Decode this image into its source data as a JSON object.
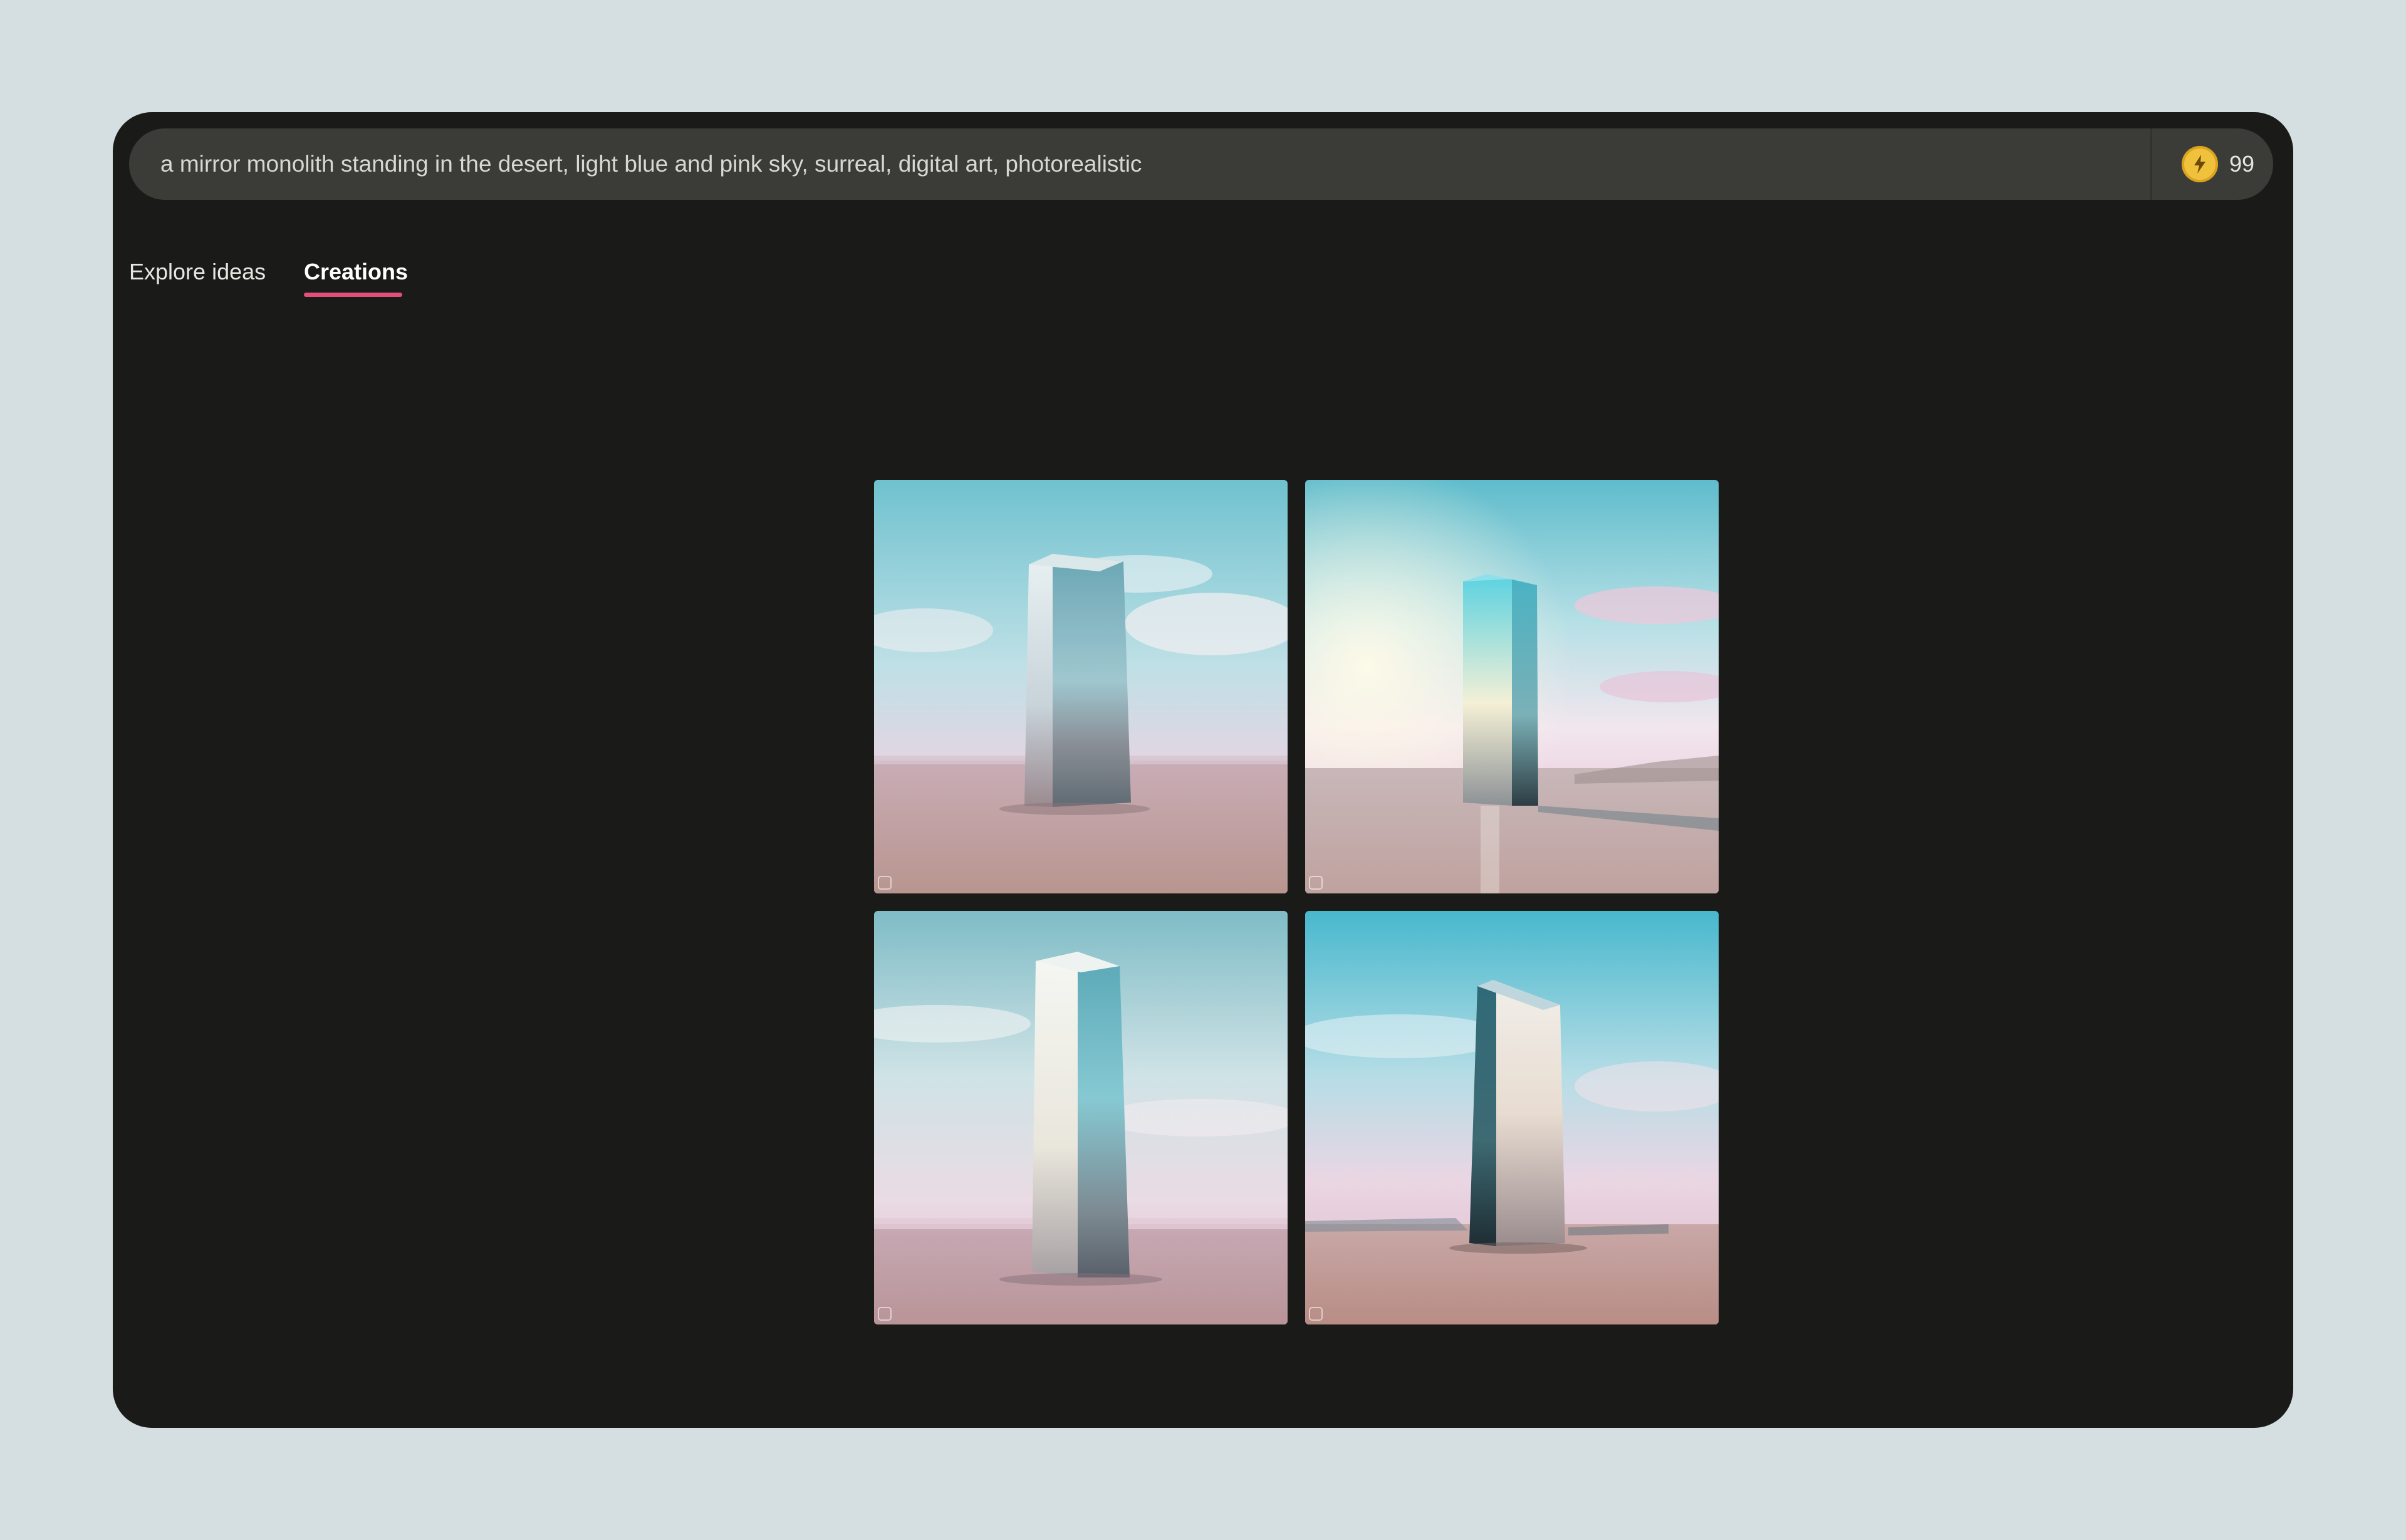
{
  "prompt": {
    "text": "a mirror monolith standing in the desert, light blue and pink sky, surreal, digital art, photorealistic"
  },
  "credits": {
    "icon": "lightning-coin-icon",
    "count": "99"
  },
  "tabs": [
    {
      "label": "Explore ideas",
      "active": false
    },
    {
      "label": "Creations",
      "active": true
    }
  ],
  "colors": {
    "accent": "#e0507b",
    "window_bg": "#1a1b18",
    "prompt_bg": "#3b3c38",
    "page_bg": "#d5dfe1",
    "coin": "#f0c23c"
  },
  "gallery": {
    "images": [
      {
        "name": "generated-image-1",
        "subject": "mirror monolith in desert"
      },
      {
        "name": "generated-image-2",
        "subject": "mirror monolith in desert"
      },
      {
        "name": "generated-image-3",
        "subject": "mirror monolith in desert"
      },
      {
        "name": "generated-image-4",
        "subject": "mirror monolith in desert"
      }
    ]
  }
}
